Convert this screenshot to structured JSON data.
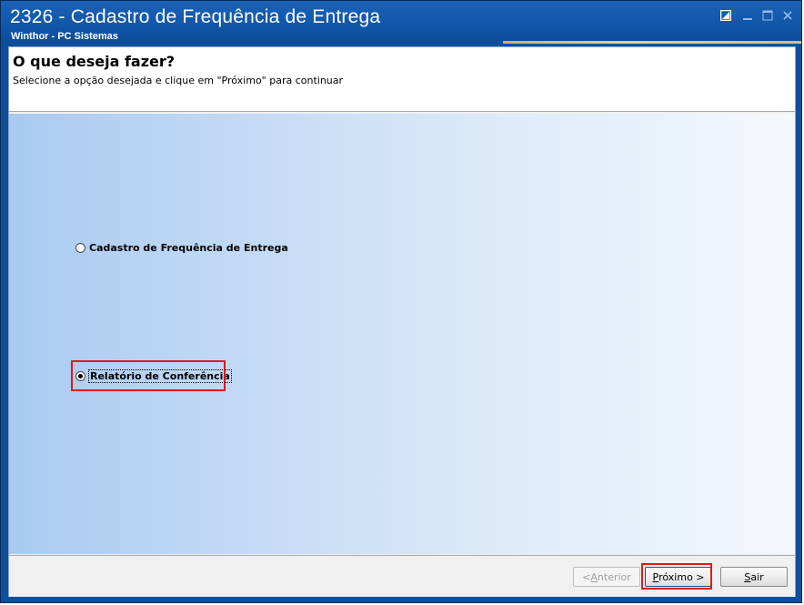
{
  "window": {
    "title": "2326 - Cadastro de Frequência de Entrega",
    "subtitle": "Winthor - PC Sistemas",
    "controls": {
      "restore_icon": "restore-icon",
      "minimize_icon": "minimize-icon",
      "maximize_icon": "maximize-icon",
      "close_icon": "close-icon"
    }
  },
  "header": {
    "title": "O que deseja fazer?",
    "description": "Selecione a opção desejada e clique em \"Próximo\" para continuar"
  },
  "options": [
    {
      "label": "Cadastro de Frequência de Entrega",
      "selected": false
    },
    {
      "label": "Relatório de Conferência",
      "selected": true
    }
  ],
  "footer": {
    "previous_prefix": "< ",
    "previous_hotkey": "A",
    "previous_rest": "nterior",
    "next_hotkey": "P",
    "next_rest": "róximo >",
    "exit_hotkey": "S",
    "exit_rest": "air"
  },
  "colors": {
    "highlight": "#e01a1a",
    "titlebar": "#0f56a8"
  }
}
